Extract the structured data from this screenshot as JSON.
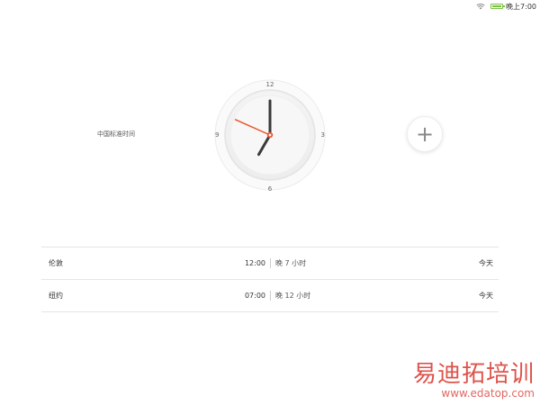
{
  "status_bar": {
    "time": "晚上7:00",
    "battery_color": "#7ac143"
  },
  "timezone": {
    "label": "中国标准时间"
  },
  "clock": {
    "numbers": {
      "top": "12",
      "right": "3",
      "bottom": "6",
      "left": "9"
    },
    "display_time": {
      "hour": 7,
      "minute": 0,
      "second": 49
    },
    "hand_color": "#3a3a3a",
    "second_hand_color": "#e8542b"
  },
  "add_button": {
    "icon": "plus-icon",
    "symbol": "+"
  },
  "cities": [
    {
      "name": "伦敦",
      "time": "12:00",
      "offset": "晚 7 小时",
      "day": "今天"
    },
    {
      "name": "纽约",
      "time": "07:00",
      "offset": "晚 12 小时",
      "day": "今天"
    }
  ],
  "watermark": {
    "text": "易迪拓培训",
    "url": "www.edatop.com"
  }
}
